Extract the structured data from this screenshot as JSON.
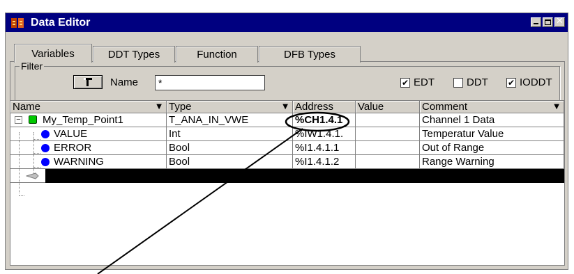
{
  "window": {
    "title": "Data Editor",
    "icons": {
      "app": "data-editor-icon",
      "minimize": "minimize-icon",
      "maximize": "maximize-icon",
      "close": "close-icon"
    }
  },
  "tabs": [
    {
      "label": "Variables",
      "active": true
    },
    {
      "label": "DDT Types",
      "active": false
    },
    {
      "label": "Function",
      "active": false
    },
    {
      "label": "DFB Types",
      "active": false
    }
  ],
  "filter": {
    "group_label": "Filter",
    "button_icon": "filter-icon",
    "name_label": "Name",
    "name_value": "*",
    "checkboxes": [
      {
        "label": "EDT",
        "checked": true
      },
      {
        "label": "DDT",
        "checked": false
      },
      {
        "label": "IODDT",
        "checked": true
      }
    ]
  },
  "table": {
    "columns": [
      {
        "label": "Name",
        "sortable": true
      },
      {
        "label": "Type",
        "sortable": true
      },
      {
        "label": "Address",
        "sortable": false
      },
      {
        "label": "Value",
        "sortable": false
      },
      {
        "label": "Comment",
        "sortable": true
      }
    ],
    "rows": [
      {
        "name": "My_Temp_Point1",
        "type": "T_ANA_IN_VWE",
        "address": "%CH1.4.1",
        "value": "",
        "comment": "Channel 1 Data",
        "expander": "−",
        "icon": "ddt-instance-icon"
      },
      {
        "name": "VALUE",
        "type": "Int",
        "address": "%IW1.4.1.",
        "value": "",
        "comment": "Temperatur Value",
        "icon": "variable-icon"
      },
      {
        "name": "ERROR",
        "type": "Bool",
        "address": "%I1.4.1.1",
        "value": "",
        "comment": "Out of Range",
        "icon": "variable-icon"
      },
      {
        "name": "WARNING",
        "type": "Bool",
        "address": "%I1.4.1.2",
        "value": "",
        "comment": "Range Warning",
        "icon": "variable-icon"
      }
    ],
    "new_row_icon": "edit-pencil-icon"
  },
  "colors": {
    "titlebar": "#000080",
    "window_bg": "#d4d0c8",
    "highlight_circle": "#000000"
  }
}
